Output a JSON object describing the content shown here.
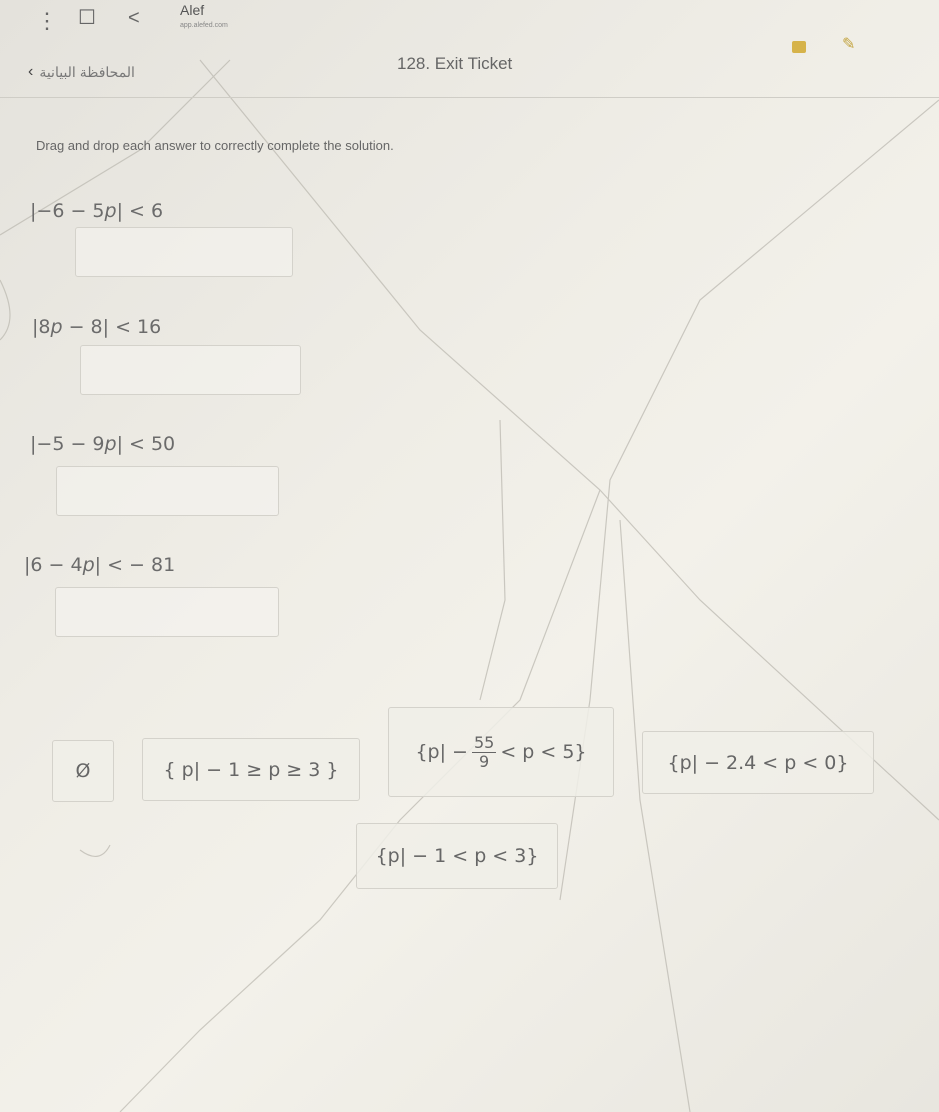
{
  "topbar": {
    "app_name": "Alef",
    "app_url": "app.alefed.com",
    "menu_icon": "kebab-menu-icon",
    "bookmark_icon": "bookmark-icon",
    "share_icon": "share-icon"
  },
  "header": {
    "back_label": "المحافظة البيانية",
    "title": "128. Exit Ticket"
  },
  "instruction": "Drag and drop each answer to correctly complete the solution.",
  "problems": [
    {
      "lead": "|−6 − 5",
      "var": "p",
      "tail": "| < 6"
    },
    {
      "lead": "|8",
      "var": "p",
      "tail": " − 8| < 16"
    },
    {
      "lead": "|−5 − 9",
      "var": "p",
      "tail": "| < 50"
    },
    {
      "lead": "|6 − 4",
      "var": "p",
      "tail": "| < − 81"
    }
  ],
  "answers": {
    "empty_set": "Ø",
    "a1": "{ p| − 1 ≥ p ≥ 3 }",
    "a2_pre": "{p| −",
    "a2_num": "55",
    "a2_den": "9",
    "a2_post": "< p < 5}",
    "a3": "{p| − 2.4 < p < 0}",
    "a4": "{p| − 1 < p < 3}"
  },
  "colors": {
    "accent": "#d6b34a",
    "border": "#d4d2cb"
  }
}
